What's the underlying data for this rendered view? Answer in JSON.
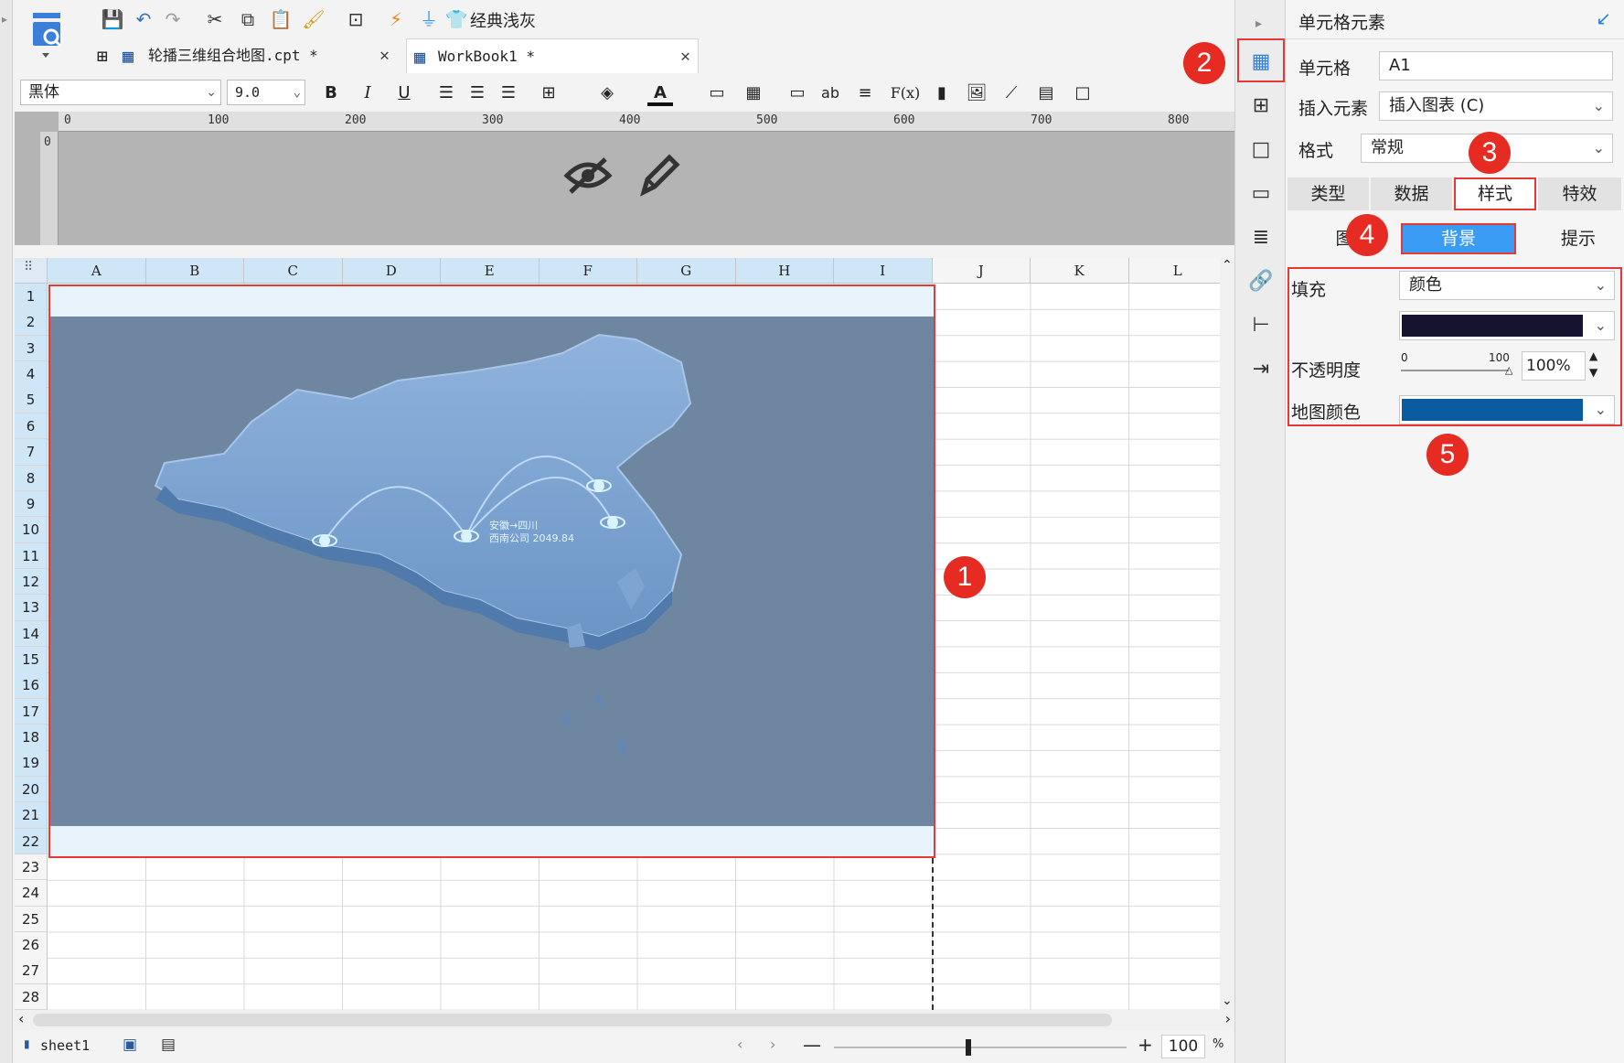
{
  "toolbar": {
    "theme_label": "经典浅灰"
  },
  "tabs": [
    {
      "label": "轮播三维组合地图.cpt *",
      "active": false
    },
    {
      "label": "WorkBook1 *",
      "active": true
    }
  ],
  "format_bar": {
    "font_family": "黑体",
    "font_size": "9.0",
    "bold": "B",
    "italic": "I",
    "underline": "U",
    "text_label": "ab",
    "fx_label": "F(x)"
  },
  "ruler": {
    "ticks": [
      "0",
      "100",
      "200",
      "300",
      "400",
      "500",
      "600",
      "700",
      "800"
    ],
    "vertical_zero": "0"
  },
  "sheet": {
    "columns": [
      "A",
      "B",
      "C",
      "D",
      "E",
      "F",
      "G",
      "H",
      "I",
      "J",
      "K",
      "L"
    ],
    "rows": [
      "1",
      "2",
      "3",
      "4",
      "5",
      "6",
      "7",
      "8",
      "9",
      "10",
      "11",
      "12",
      "13",
      "14",
      "15",
      "16",
      "17",
      "18",
      "19",
      "20",
      "21",
      "22",
      "23",
      "24",
      "25",
      "26",
      "27",
      "28"
    ],
    "map_label_line1": "安徽→四川",
    "map_label_line2": "西南公司 2049.84"
  },
  "statusbar": {
    "sheet_name": "sheet1",
    "zoom_value": "100",
    "zoom_unit": "%"
  },
  "panel": {
    "title": "单元格元素",
    "cell_label": "单元格",
    "cell_value": "A1",
    "insert_label": "插入元素",
    "insert_value": "插入图表 (C)",
    "format_label": "格式",
    "format_value": "常规",
    "tabs": [
      "类型",
      "数据",
      "样式",
      "特效"
    ],
    "subtabs": [
      "图",
      "背景",
      "提示"
    ],
    "fill_label": "填充",
    "fill_value": "颜色",
    "opacity_label": "不透明度",
    "opacity_min": "0",
    "opacity_max": "100",
    "opacity_value": "100%",
    "map_color_label": "地图颜色",
    "fill_color": "#15132e",
    "map_color": "#0b5ba0"
  },
  "badges": [
    "1",
    "2",
    "3",
    "4",
    "5"
  ],
  "colors": {
    "accent": "#3b9cf5",
    "highlight": "#e53935",
    "map_background": "#6f86a0"
  }
}
